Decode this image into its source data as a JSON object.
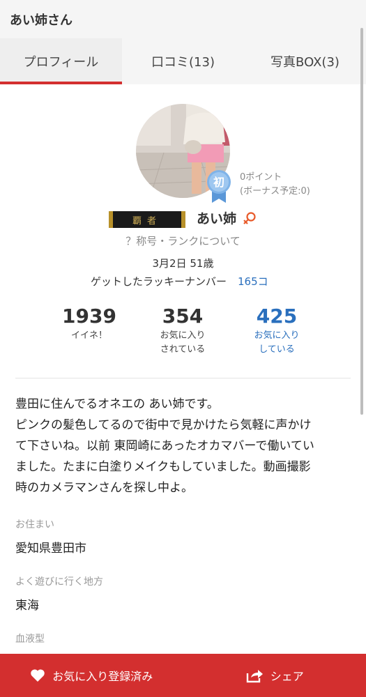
{
  "header": {
    "title": "あい姉さん"
  },
  "tabs": [
    {
      "label": "プロフィール"
    },
    {
      "label": "口コミ(13)"
    },
    {
      "label": "写真BOX(3)"
    }
  ],
  "profile": {
    "badge_char": "初",
    "points": "0ポイント",
    "bonus": "(ボーナス予定:0)",
    "rank_title": "覇者",
    "name": "あい姉",
    "rank_link": "？称号・ランクについて",
    "birthday": "3月2日 51歳",
    "lucky_label": "ゲットしたラッキーナンバー",
    "lucky_value": "165コ"
  },
  "stats": [
    {
      "value": "1939",
      "label_1": "イイネ！",
      "label_2": ""
    },
    {
      "value": "354",
      "label_1": "お気に入り",
      "label_2": "されている"
    },
    {
      "value": "425",
      "label_1": "お気に入り",
      "label_2": "している"
    }
  ],
  "bio": {
    "line_1": "豊田に住んでるオネエの あい姉です。",
    "line_2": "ピンクの髪色してるので街中で見かけたら気軽に声かけ",
    "line_3": "て下さいね。以前 東岡崎にあったオカマバーで働いてい",
    "line_4": "ました。たまに白塗りメイクもしていました。動画撮影",
    "line_5": "時のカメラマンさんを探し中よ。"
  },
  "fields": [
    {
      "label": "お住まい",
      "value": "愛知県豊田市"
    },
    {
      "label": "よく遊びに行く地方",
      "value": "東海"
    },
    {
      "label": "血液型",
      "value": ""
    }
  ],
  "bottom_bar": {
    "favorite_label": "お気に入り登録済み",
    "share_label": "シェア"
  },
  "colors": {
    "accent": "#d32f2f",
    "link": "#2a6fbd"
  }
}
